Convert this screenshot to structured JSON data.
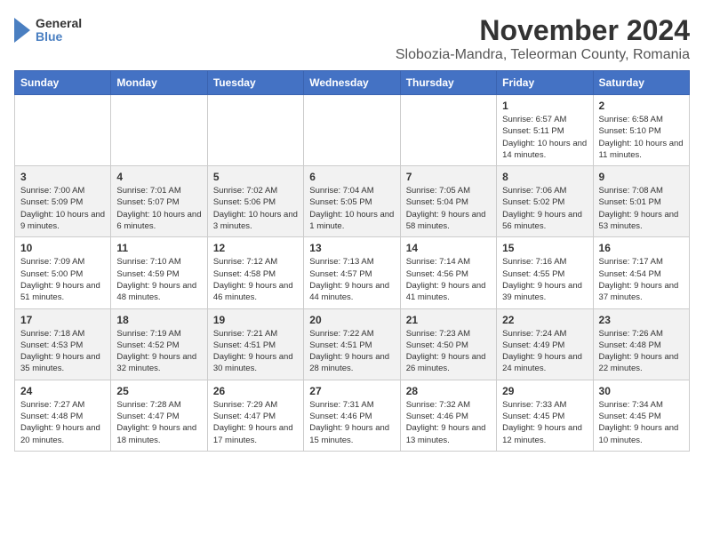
{
  "logo": {
    "general": "General",
    "blue": "Blue"
  },
  "header": {
    "month": "November 2024",
    "location": "Slobozia-Mandra, Teleorman County, Romania"
  },
  "weekdays": [
    "Sunday",
    "Monday",
    "Tuesday",
    "Wednesday",
    "Thursday",
    "Friday",
    "Saturday"
  ],
  "weeks": [
    [
      {
        "day": "",
        "info": ""
      },
      {
        "day": "",
        "info": ""
      },
      {
        "day": "",
        "info": ""
      },
      {
        "day": "",
        "info": ""
      },
      {
        "day": "",
        "info": ""
      },
      {
        "day": "1",
        "info": "Sunrise: 6:57 AM\nSunset: 5:11 PM\nDaylight: 10 hours and 14 minutes."
      },
      {
        "day": "2",
        "info": "Sunrise: 6:58 AM\nSunset: 5:10 PM\nDaylight: 10 hours and 11 minutes."
      }
    ],
    [
      {
        "day": "3",
        "info": "Sunrise: 7:00 AM\nSunset: 5:09 PM\nDaylight: 10 hours and 9 minutes."
      },
      {
        "day": "4",
        "info": "Sunrise: 7:01 AM\nSunset: 5:07 PM\nDaylight: 10 hours and 6 minutes."
      },
      {
        "day": "5",
        "info": "Sunrise: 7:02 AM\nSunset: 5:06 PM\nDaylight: 10 hours and 3 minutes."
      },
      {
        "day": "6",
        "info": "Sunrise: 7:04 AM\nSunset: 5:05 PM\nDaylight: 10 hours and 1 minute."
      },
      {
        "day": "7",
        "info": "Sunrise: 7:05 AM\nSunset: 5:04 PM\nDaylight: 9 hours and 58 minutes."
      },
      {
        "day": "8",
        "info": "Sunrise: 7:06 AM\nSunset: 5:02 PM\nDaylight: 9 hours and 56 minutes."
      },
      {
        "day": "9",
        "info": "Sunrise: 7:08 AM\nSunset: 5:01 PM\nDaylight: 9 hours and 53 minutes."
      }
    ],
    [
      {
        "day": "10",
        "info": "Sunrise: 7:09 AM\nSunset: 5:00 PM\nDaylight: 9 hours and 51 minutes."
      },
      {
        "day": "11",
        "info": "Sunrise: 7:10 AM\nSunset: 4:59 PM\nDaylight: 9 hours and 48 minutes."
      },
      {
        "day": "12",
        "info": "Sunrise: 7:12 AM\nSunset: 4:58 PM\nDaylight: 9 hours and 46 minutes."
      },
      {
        "day": "13",
        "info": "Sunrise: 7:13 AM\nSunset: 4:57 PM\nDaylight: 9 hours and 44 minutes."
      },
      {
        "day": "14",
        "info": "Sunrise: 7:14 AM\nSunset: 4:56 PM\nDaylight: 9 hours and 41 minutes."
      },
      {
        "day": "15",
        "info": "Sunrise: 7:16 AM\nSunset: 4:55 PM\nDaylight: 9 hours and 39 minutes."
      },
      {
        "day": "16",
        "info": "Sunrise: 7:17 AM\nSunset: 4:54 PM\nDaylight: 9 hours and 37 minutes."
      }
    ],
    [
      {
        "day": "17",
        "info": "Sunrise: 7:18 AM\nSunset: 4:53 PM\nDaylight: 9 hours and 35 minutes."
      },
      {
        "day": "18",
        "info": "Sunrise: 7:19 AM\nSunset: 4:52 PM\nDaylight: 9 hours and 32 minutes."
      },
      {
        "day": "19",
        "info": "Sunrise: 7:21 AM\nSunset: 4:51 PM\nDaylight: 9 hours and 30 minutes."
      },
      {
        "day": "20",
        "info": "Sunrise: 7:22 AM\nSunset: 4:51 PM\nDaylight: 9 hours and 28 minutes."
      },
      {
        "day": "21",
        "info": "Sunrise: 7:23 AM\nSunset: 4:50 PM\nDaylight: 9 hours and 26 minutes."
      },
      {
        "day": "22",
        "info": "Sunrise: 7:24 AM\nSunset: 4:49 PM\nDaylight: 9 hours and 24 minutes."
      },
      {
        "day": "23",
        "info": "Sunrise: 7:26 AM\nSunset: 4:48 PM\nDaylight: 9 hours and 22 minutes."
      }
    ],
    [
      {
        "day": "24",
        "info": "Sunrise: 7:27 AM\nSunset: 4:48 PM\nDaylight: 9 hours and 20 minutes."
      },
      {
        "day": "25",
        "info": "Sunrise: 7:28 AM\nSunset: 4:47 PM\nDaylight: 9 hours and 18 minutes."
      },
      {
        "day": "26",
        "info": "Sunrise: 7:29 AM\nSunset: 4:47 PM\nDaylight: 9 hours and 17 minutes."
      },
      {
        "day": "27",
        "info": "Sunrise: 7:31 AM\nSunset: 4:46 PM\nDaylight: 9 hours and 15 minutes."
      },
      {
        "day": "28",
        "info": "Sunrise: 7:32 AM\nSunset: 4:46 PM\nDaylight: 9 hours and 13 minutes."
      },
      {
        "day": "29",
        "info": "Sunrise: 7:33 AM\nSunset: 4:45 PM\nDaylight: 9 hours and 12 minutes."
      },
      {
        "day": "30",
        "info": "Sunrise: 7:34 AM\nSunset: 4:45 PM\nDaylight: 9 hours and 10 minutes."
      }
    ]
  ]
}
